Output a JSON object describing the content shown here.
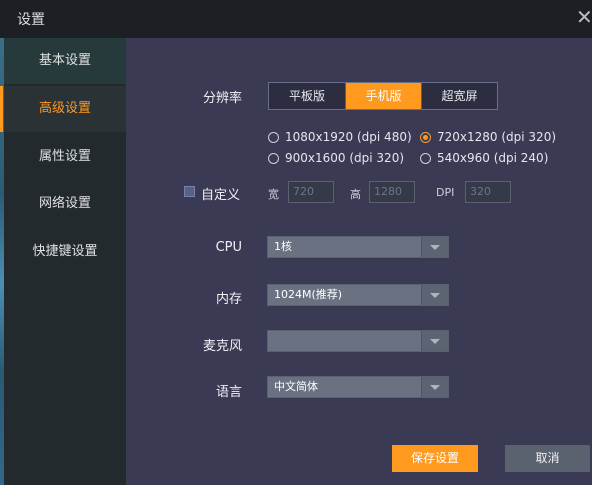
{
  "window": {
    "title": "设置"
  },
  "colors": {
    "accent": "#ff9a1f",
    "panel_bg": "#3a3a54",
    "sidebar_bg": "#232a2e"
  },
  "sidebar": {
    "items": [
      {
        "label": "基本设置",
        "active": false
      },
      {
        "label": "高级设置",
        "active": true
      },
      {
        "label": "属性设置",
        "active": false
      },
      {
        "label": "网络设置",
        "active": false
      },
      {
        "label": "快捷键设置",
        "active": false
      }
    ]
  },
  "resolution": {
    "label": "分辨率",
    "modes": [
      "平板版",
      "手机版",
      "超宽屏"
    ],
    "selected_mode": "手机版",
    "options": [
      "1080x1920 (dpi 480)",
      "720x1280 (dpi 320)",
      "900x1600 (dpi 320)",
      "540x960 (dpi 240)"
    ],
    "selected_option": "720x1280 (dpi 320)"
  },
  "custom": {
    "label": "自定义",
    "checked": false,
    "width_label": "宽",
    "width_value": "720",
    "height_label": "高",
    "height_value": "1280",
    "dpi_label": "DPI",
    "dpi_value": "320"
  },
  "cpu": {
    "label": "CPU",
    "value": "1核"
  },
  "memory": {
    "label": "内存",
    "value": "1024M(推荐)"
  },
  "microphone": {
    "label": "麦克风",
    "value": ""
  },
  "language": {
    "label": "语言",
    "value": "中文简体"
  },
  "actions": {
    "save": "保存设置",
    "cancel": "取消"
  }
}
